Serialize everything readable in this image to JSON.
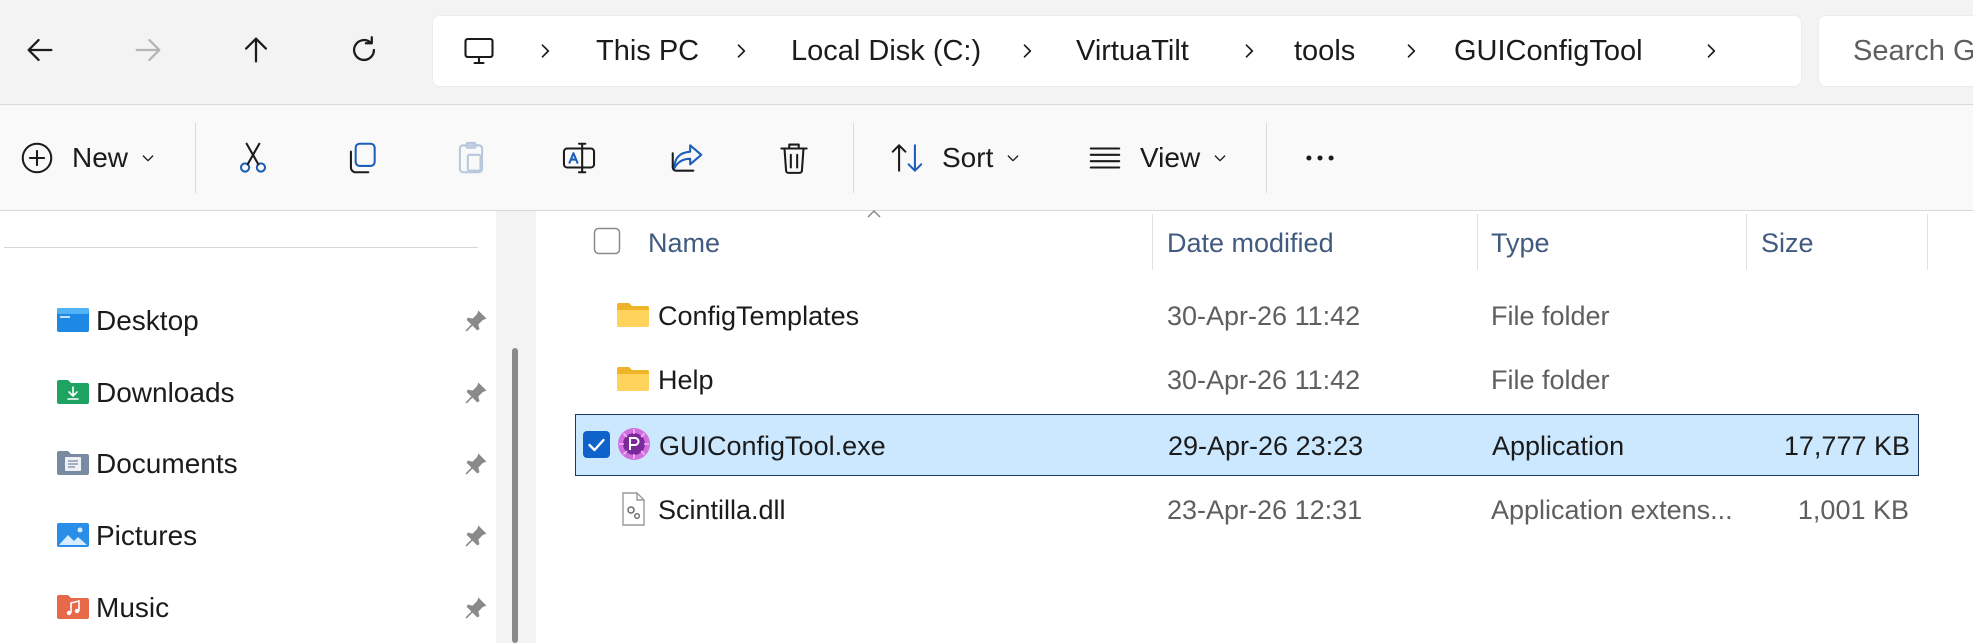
{
  "address": {
    "crumbs": [
      "This PC",
      "Local Disk (C:)",
      "VirtuaTilt",
      "tools",
      "GUIConfigTool"
    ],
    "search_placeholder": "Search G"
  },
  "commandbar": {
    "new_label": "New",
    "sort_label": "Sort",
    "view_label": "View"
  },
  "sidebar": {
    "items": [
      {
        "label": "Desktop",
        "icon": "desktop-folder-icon",
        "color": "#1e88e5"
      },
      {
        "label": "Downloads",
        "icon": "downloads-folder-icon",
        "color": "#1ea362"
      },
      {
        "label": "Documents",
        "icon": "documents-folder-icon",
        "color": "#7a8aa3"
      },
      {
        "label": "Pictures",
        "icon": "pictures-folder-icon",
        "color": "#2a8ee8"
      },
      {
        "label": "Music",
        "icon": "music-folder-icon",
        "color": "#e8684a"
      }
    ]
  },
  "filelist": {
    "columns": {
      "name": "Name",
      "date": "Date modified",
      "type": "Type",
      "size": "Size"
    },
    "rows": [
      {
        "name": "ConfigTemplates",
        "date": "30-Apr-26 11:42",
        "type": "File folder",
        "size": "",
        "icon": "folder-icon",
        "selected": false
      },
      {
        "name": "Help",
        "date": "30-Apr-26 11:42",
        "type": "File folder",
        "size": "",
        "icon": "folder-icon",
        "selected": false
      },
      {
        "name": "GUIConfigTool.exe",
        "date": "29-Apr-26 23:23",
        "type": "Application",
        "size": "17,777 KB",
        "icon": "app-icon",
        "selected": true
      },
      {
        "name": "Scintilla.dll",
        "date": "23-Apr-26 12:31",
        "type": "Application extens...",
        "size": "1,001 KB",
        "icon": "dll-file-icon",
        "selected": false
      }
    ]
  },
  "colors": {
    "selection": "#cce8ff",
    "accent": "#0f62c9",
    "header_text": "#405a80"
  }
}
